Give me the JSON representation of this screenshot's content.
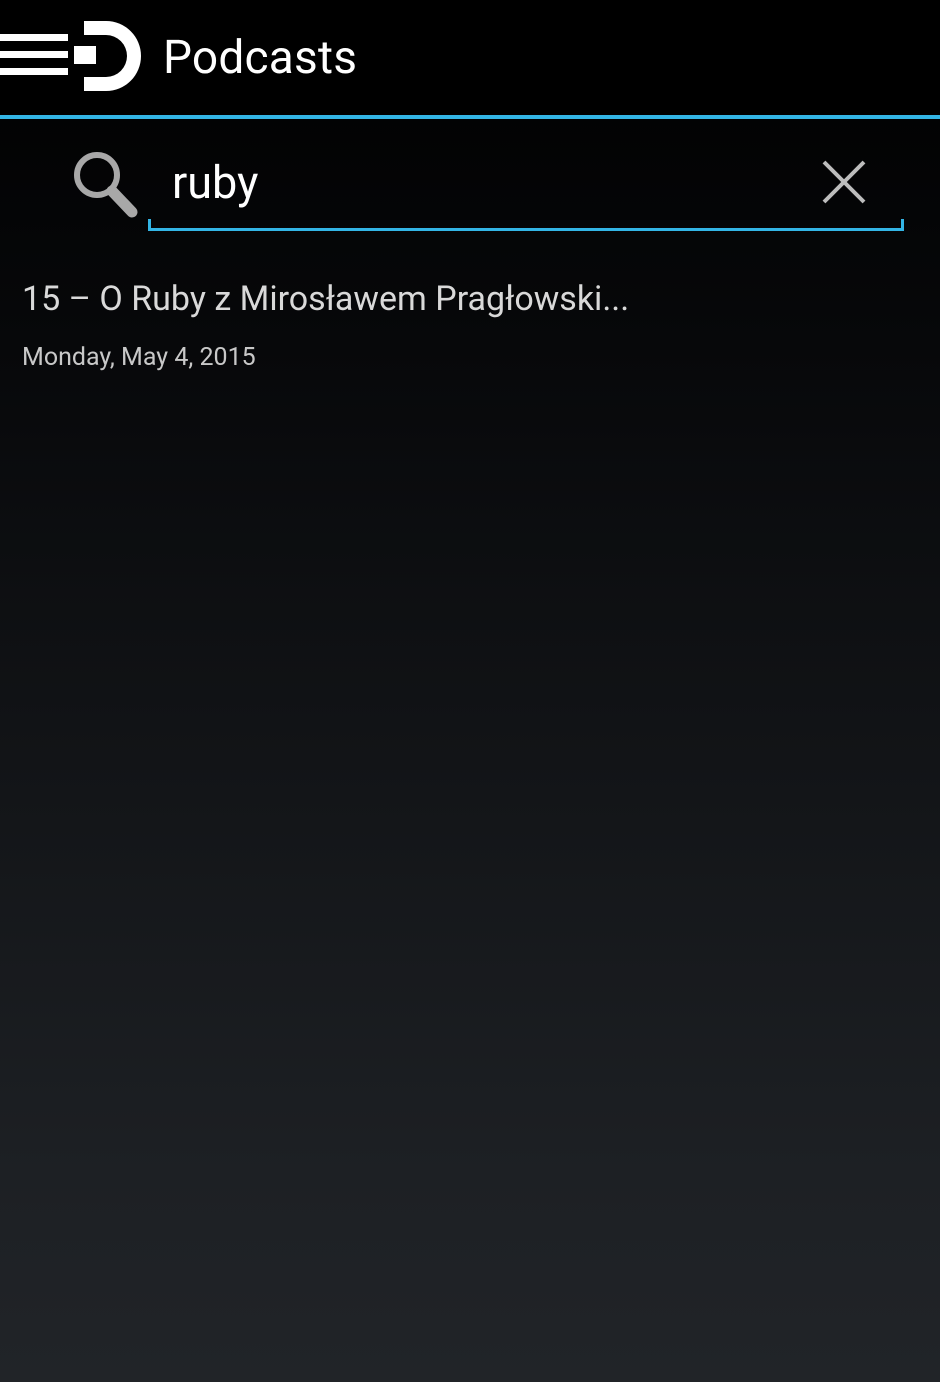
{
  "colors": {
    "accent": "#33b5e5",
    "background_top": "#000000",
    "background_bottom": "#212428",
    "text_primary": "#ffffff",
    "text_secondary": "#d9d9d9"
  },
  "action_bar": {
    "drawer_icon": "navigation-drawer-icon",
    "logo_icon": "app-logo-d-icon",
    "title": "Podcasts"
  },
  "search": {
    "icon": "search-icon",
    "value": "ruby",
    "placeholder": "",
    "clear_icon": "close-icon"
  },
  "results": [
    {
      "title": "15 – O Ruby z Mirosławem Pragłowski...",
      "date": "Monday, May 4, 2015"
    }
  ]
}
